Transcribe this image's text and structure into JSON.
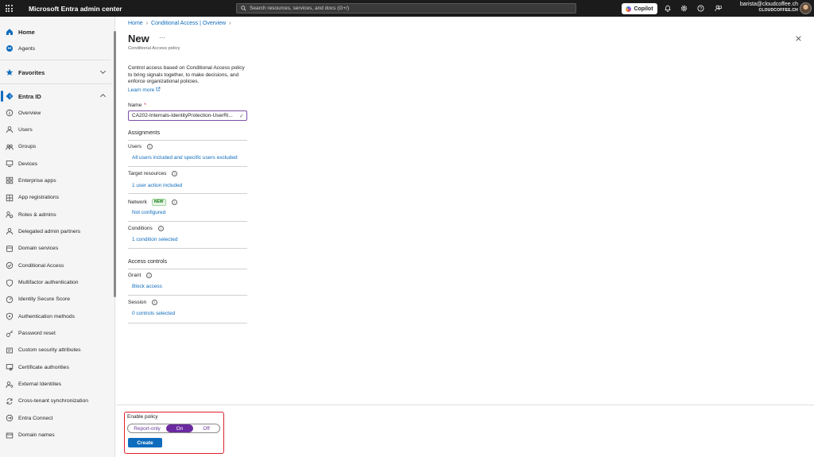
{
  "topbar": {
    "app_title": "Microsoft Entra admin center",
    "search_placeholder": "Search resources, services, and docs (G+/)",
    "copilot_label": "Copilot",
    "account_email": "barista@cloudcoffee.ch",
    "account_tenant": "CLOUDCOFFEE.CH"
  },
  "sidebar": {
    "top_items": [
      {
        "label": "Home",
        "icon": "home-icon"
      },
      {
        "label": "Agents",
        "icon": "agents-icon"
      },
      {
        "label": "Favorites",
        "icon": "star-icon"
      },
      {
        "label": "Entra ID",
        "icon": "entra-diamond-icon"
      }
    ],
    "items": [
      {
        "label": "Overview",
        "icon": "info-icon"
      },
      {
        "label": "Users",
        "icon": "user-icon"
      },
      {
        "label": "Groups",
        "icon": "groups-icon"
      },
      {
        "label": "Devices",
        "icon": "device-icon"
      },
      {
        "label": "Enterprise apps",
        "icon": "apps-icon"
      },
      {
        "label": "App registrations",
        "icon": "app-registrations-icon"
      },
      {
        "label": "Roles & admins",
        "icon": "roles-icon"
      },
      {
        "label": "Delegated admin partners",
        "icon": "partners-icon"
      },
      {
        "label": "Domain services",
        "icon": "domain-services-icon"
      },
      {
        "label": "Conditional Access",
        "icon": "conditional-access-icon"
      },
      {
        "label": "Multifactor authentication",
        "icon": "shield-icon"
      },
      {
        "label": "Identity Secure Score",
        "icon": "score-icon"
      },
      {
        "label": "Authentication methods",
        "icon": "auth-methods-icon"
      },
      {
        "label": "Password reset",
        "icon": "key-icon"
      },
      {
        "label": "Custom security attributes",
        "icon": "attributes-icon"
      },
      {
        "label": "Certificate authorities",
        "icon": "certificate-icon"
      },
      {
        "label": "External Identities",
        "icon": "external-identities-icon"
      },
      {
        "label": "Cross-tenant synchronization",
        "icon": "sync-icon"
      },
      {
        "label": "Entra Connect",
        "icon": "connect-icon"
      },
      {
        "label": "Domain names",
        "icon": "domain-names-icon"
      }
    ]
  },
  "main": {
    "breadcrumb": [
      "Home",
      "Conditional Access | Overview"
    ],
    "title": "New",
    "more_label": "···",
    "subtitle": "Conditional Access policy",
    "description": "Control access based on Conditional Access policy to bring signals together, to make decisions, and enforce organizational policies.",
    "learn_more": "Learn more",
    "name_label": "Name",
    "name_required": "*",
    "name_value": "CA202-Internals-IdentityProtection-UserRi...",
    "assignments_heading": "Assignments",
    "users_label": "Users",
    "users_value": "All users included and specific users excluded",
    "target_label": "Target resources",
    "target_value": "1 user action included",
    "network_label": "Network",
    "network_badge": "NEW",
    "network_value": "Not configured",
    "conditions_label": "Conditions",
    "conditions_value": "1 condition selected",
    "access_controls_heading": "Access controls",
    "grant_label": "Grant",
    "grant_value": "Block access",
    "session_label": "Session",
    "session_value": "0 controls selected"
  },
  "footer": {
    "enable_label": "Enable policy",
    "options": [
      "Report-only",
      "On",
      "Off"
    ],
    "selected": "On",
    "create_label": "Create"
  },
  "colors": {
    "accent": "#0f6cbd",
    "toggle_selected": "#6b2aa0",
    "highlight_border": "#e0202b"
  }
}
